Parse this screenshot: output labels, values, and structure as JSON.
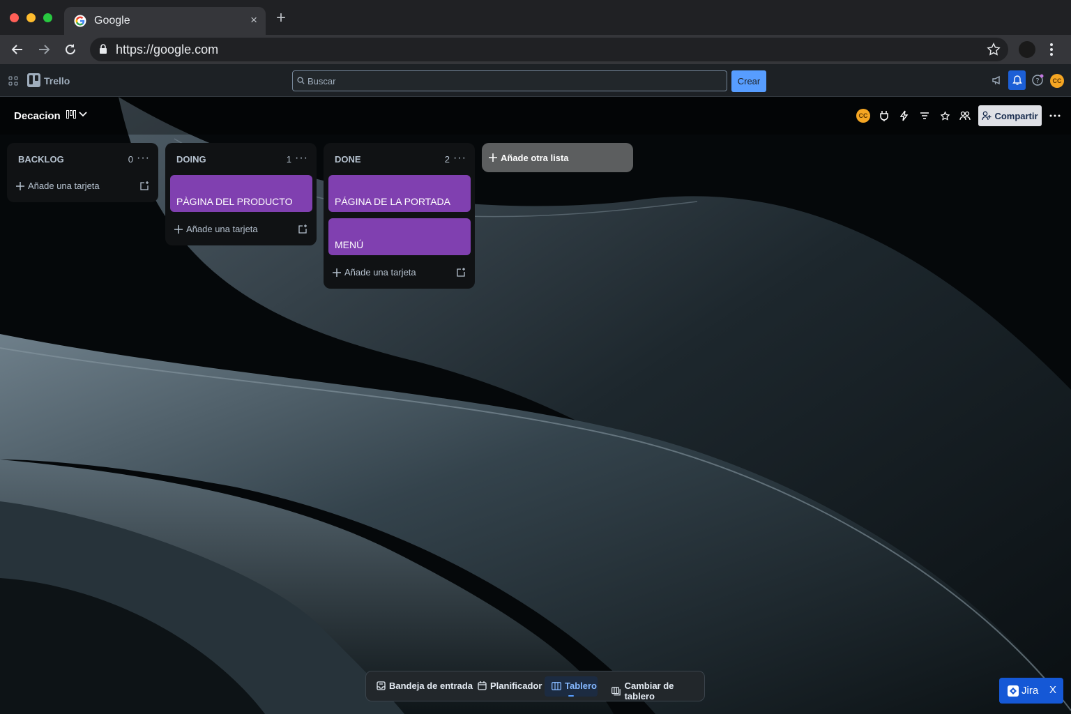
{
  "browser": {
    "tab_title": "Google",
    "tab_close": "×",
    "new_tab": "+",
    "url": "https://google.com"
  },
  "trello_header": {
    "app_name": "Trello",
    "search_placeholder": "Buscar",
    "create_label": "Crear",
    "avatar_initials": "CC"
  },
  "board": {
    "title": "Decacion",
    "share_label": "Compartir",
    "member_initials": "CC",
    "lists": [
      {
        "title": "BACKLOG",
        "count": "0",
        "cards": [],
        "add_card_label": "Añade una tarjeta"
      },
      {
        "title": "DOING",
        "count": "1",
        "cards": [
          {
            "title": "PÀGINA DEL PRODUCTO"
          }
        ],
        "add_card_label": "Añade una tarjeta"
      },
      {
        "title": "DONE",
        "count": "2",
        "cards": [
          {
            "title": "PÁGINA DE LA PORTADA"
          },
          {
            "title": "MENÚ"
          }
        ],
        "add_card_label": "Añade una tarjeta"
      }
    ],
    "add_list_label": "Añade otra lista",
    "card_color": "#8040b0"
  },
  "bottom_nav": {
    "items": [
      {
        "label": "Bandeja de entrada"
      },
      {
        "label": "Planificador"
      },
      {
        "label": "Tablero",
        "active": true
      },
      {
        "label": "Cambiar de tablero"
      }
    ]
  },
  "jira": {
    "label": "Jira",
    "close": "X"
  },
  "colors": {
    "accent": "#579dff",
    "card": "#8040b0",
    "avatar": "#f5a623"
  }
}
